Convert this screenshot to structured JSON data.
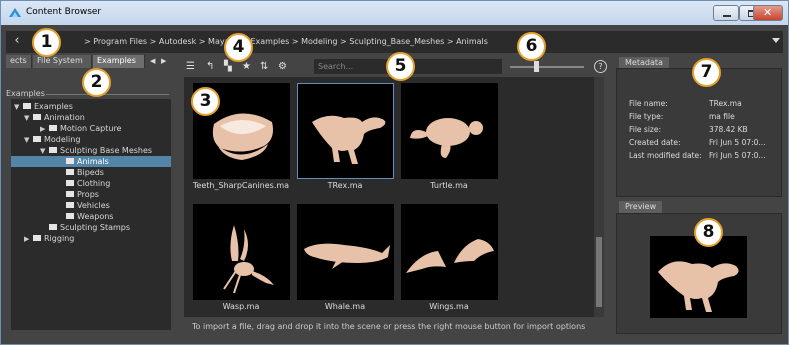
{
  "window": {
    "title": "Content Browser"
  },
  "path": {
    "back_label": "‹",
    "crumbs": "> Program Files > Autodesk > MayaLT20   Examples > Modeling > Sculpting_Base_Meshes > Animals"
  },
  "left": {
    "tabs": [
      {
        "label": "ects"
      },
      {
        "label": "File System"
      },
      {
        "label": "Examples"
      }
    ],
    "section_label": "Examples",
    "tree": [
      {
        "label": "Examples",
        "expanded": true
      },
      {
        "label": "Animation",
        "expanded": true
      },
      {
        "label": "Motion Capture",
        "expanded": false
      },
      {
        "label": "Modeling",
        "expanded": true
      },
      {
        "label": "Sculpting Base Meshes",
        "expanded": true
      },
      {
        "label": "Animals",
        "selected": true
      },
      {
        "label": "Bipeds"
      },
      {
        "label": "Clothing"
      },
      {
        "label": "Props"
      },
      {
        "label": "Vehicles"
      },
      {
        "label": "Weapons"
      },
      {
        "label": "Sculpting Stamps"
      },
      {
        "label": "Rigging",
        "expanded": false
      }
    ]
  },
  "center": {
    "search_placeholder": "Search...",
    "help_label": "?",
    "thumbs": [
      {
        "label": "Teeth_SharpCanines.ma",
        "icon": "teeth-icon"
      },
      {
        "label": "TRex.ma",
        "icon": "trex-icon",
        "selected": true
      },
      {
        "label": "Turtle.ma",
        "icon": "turtle-icon"
      },
      {
        "label": "Wasp.ma",
        "icon": "wasp-icon"
      },
      {
        "label": "Whale.ma",
        "icon": "whale-icon"
      },
      {
        "label": "Wings.ma",
        "icon": "wings-icon"
      }
    ],
    "status": "To import a file, drag and drop it into the scene or press the right mouse button for import options"
  },
  "right": {
    "metadata_tab": "Metadata",
    "preview_tab": "Preview",
    "rows": [
      {
        "k": "File name:",
        "v": "TRex.ma"
      },
      {
        "k": "File type:",
        "v": "ma file"
      },
      {
        "k": "File size:",
        "v": "378.42 KB"
      },
      {
        "k": "Created date:",
        "v": "Fri Jun 5 07:0..."
      },
      {
        "k": "Last modified date:",
        "v": "Fri Jun 5 07:0..."
      }
    ]
  },
  "callouts": [
    "1",
    "2",
    "3",
    "4",
    "5",
    "6",
    "7",
    "8"
  ],
  "colors": {
    "accent": "#5285a6",
    "badge_border": "#e6a12a",
    "model": "#e8c2a8"
  }
}
